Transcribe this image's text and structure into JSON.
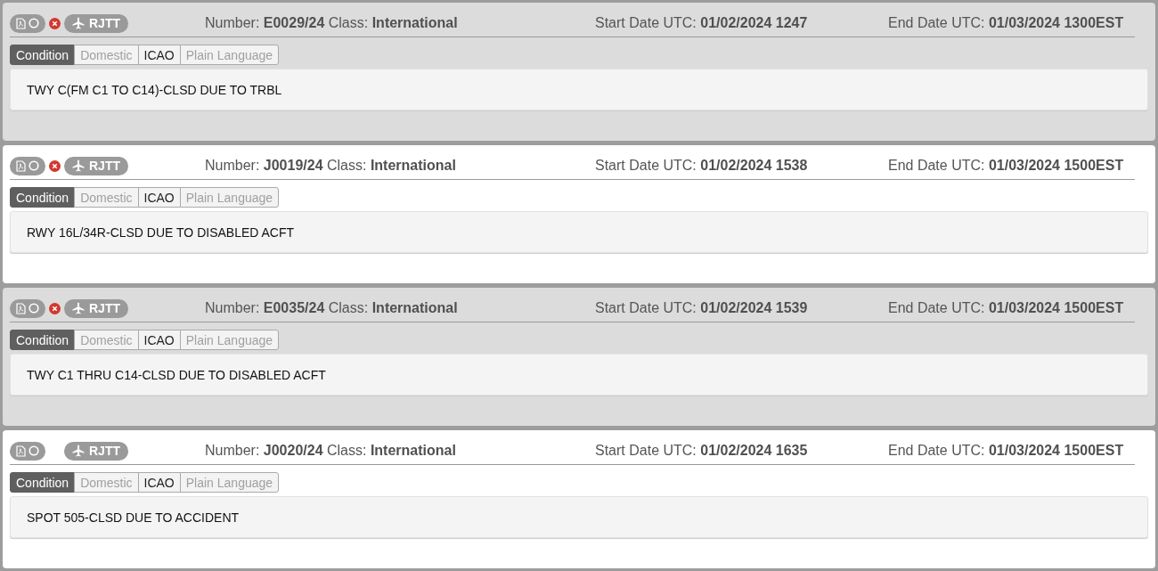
{
  "notams": [
    {
      "shaded": true,
      "cancelled": true,
      "location": "RJTT",
      "number_label": "Number:",
      "number": "E0029/24",
      "class_label": "Class:",
      "class": "International",
      "start_label": "Start Date UTC:",
      "start": "01/02/2024 1247",
      "end_label": "End Date UTC:",
      "end": "01/03/2024 1300EST",
      "tabs": [
        {
          "label": "Condition",
          "selected": true,
          "disabled": false
        },
        {
          "label": "Domestic",
          "selected": false,
          "disabled": true
        },
        {
          "label": "ICAO",
          "selected": false,
          "disabled": false
        },
        {
          "label": "Plain Language",
          "selected": false,
          "disabled": true
        }
      ],
      "text": "TWY C(FM C1 TO C14)-CLSD DUE TO TRBL"
    },
    {
      "shaded": false,
      "cancelled": true,
      "location": "RJTT",
      "number_label": "Number:",
      "number": "J0019/24",
      "class_label": "Class:",
      "class": "International",
      "start_label": "Start Date UTC:",
      "start": "01/02/2024 1538",
      "end_label": "End Date UTC:",
      "end": "01/03/2024 1500EST",
      "tabs": [
        {
          "label": "Condition",
          "selected": true,
          "disabled": false
        },
        {
          "label": "Domestic",
          "selected": false,
          "disabled": true
        },
        {
          "label": "ICAO",
          "selected": false,
          "disabled": false
        },
        {
          "label": "Plain Language",
          "selected": false,
          "disabled": true
        }
      ],
      "text": "RWY 16L/34R-CLSD DUE TO DISABLED ACFT"
    },
    {
      "shaded": true,
      "cancelled": true,
      "location": "RJTT",
      "number_label": "Number:",
      "number": "E0035/24",
      "class_label": "Class:",
      "class": "International",
      "start_label": "Start Date UTC:",
      "start": "01/02/2024 1539",
      "end_label": "End Date UTC:",
      "end": "01/03/2024 1500EST",
      "tabs": [
        {
          "label": "Condition",
          "selected": true,
          "disabled": false
        },
        {
          "label": "Domestic",
          "selected": false,
          "disabled": true
        },
        {
          "label": "ICAO",
          "selected": false,
          "disabled": false
        },
        {
          "label": "Plain Language",
          "selected": false,
          "disabled": true
        }
      ],
      "text": "TWY C1 THRU C14-CLSD DUE TO DISABLED ACFT"
    },
    {
      "shaded": false,
      "cancelled": false,
      "location": "RJTT",
      "number_label": "Number:",
      "number": "J0020/24",
      "class_label": "Class:",
      "class": "International",
      "start_label": "Start Date UTC:",
      "start": "01/02/2024 1635",
      "end_label": "End Date UTC:",
      "end": "01/03/2024 1500EST",
      "tabs": [
        {
          "label": "Condition",
          "selected": true,
          "disabled": false
        },
        {
          "label": "Domestic",
          "selected": false,
          "disabled": true
        },
        {
          "label": "ICAO",
          "selected": false,
          "disabled": false
        },
        {
          "label": "Plain Language",
          "selected": false,
          "disabled": true
        }
      ],
      "text": "SPOT 505-CLSD DUE TO ACCIDENT"
    }
  ]
}
